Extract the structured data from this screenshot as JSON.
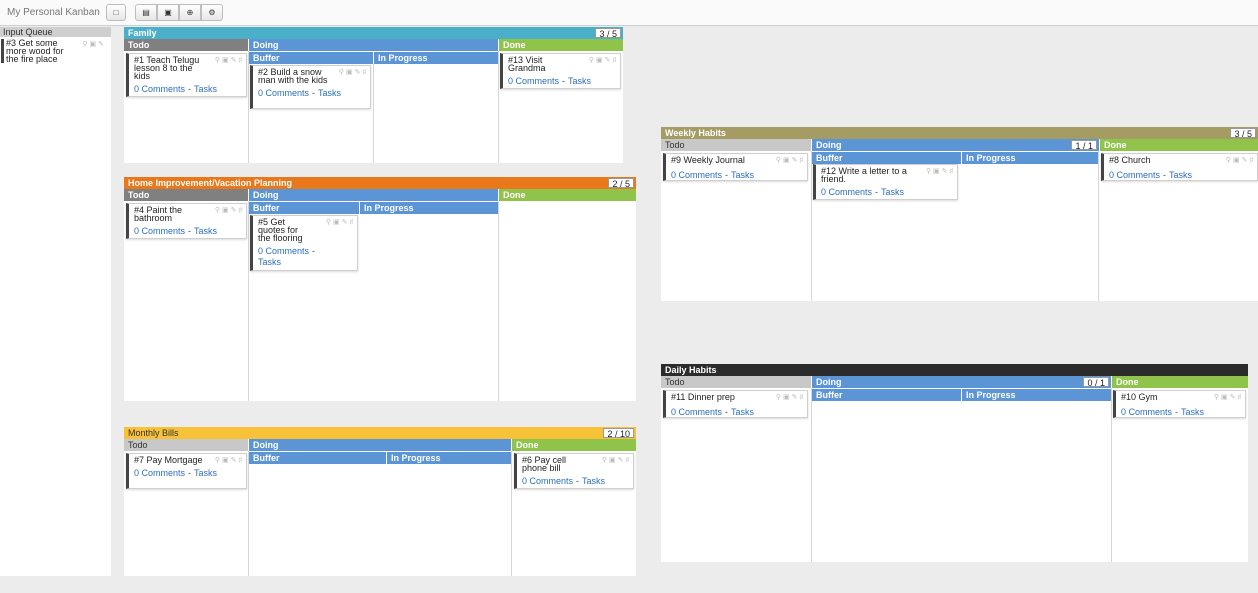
{
  "app": {
    "title": "My Personal Kanban"
  },
  "toolbar": {
    "toggle_icon": "square-outline-icon",
    "board_icon": "board-icon",
    "archive_icon": "archive-icon",
    "add_icon": "add-circle-icon",
    "settings_icon": "gear-icon"
  },
  "labels": {
    "comments": "0 Comments",
    "sep": "-",
    "tasks": "Tasks"
  },
  "input_queue": {
    "title": "Input Queue",
    "cards": [
      {
        "title": "#3 Get some more wood for the fire place"
      }
    ]
  },
  "boards": {
    "family": {
      "title": "Family",
      "wip": "3 / 5",
      "color": "#4ab0c9",
      "columns": {
        "todo": "Todo",
        "doing": "Doing",
        "buffer": "Buffer",
        "in_progress": "In Progress",
        "done": "Done"
      },
      "cards": {
        "todo": "#1 Teach Telugu lesson 8 to the kids",
        "buffer": "#2 Build a snow man with the kids",
        "done": "#13 Visit Grandma"
      }
    },
    "home": {
      "title": "Home Improvement/Vacation Planning",
      "wip": "2 / 5",
      "color": "#e8781a",
      "columns": {
        "todo": "Todo",
        "doing": "Doing",
        "buffer": "Buffer",
        "in_progress": "In Progress",
        "done": "Done"
      },
      "cards": {
        "todo": "#4 Paint the bathroom",
        "buffer": "#5 Get quotes for the flooring"
      }
    },
    "bills": {
      "title": "Monthly Bills",
      "wip": "2 / 10",
      "color": "#f7c238",
      "columns": {
        "todo": "Todo",
        "doing": "Doing",
        "buffer": "Buffer",
        "in_progress": "In Progress",
        "done": "Done"
      },
      "cards": {
        "todo": "#7 Pay Mortgage",
        "done": "#6 Pay cell phone bill"
      }
    },
    "weekly": {
      "title": "Weekly Habits",
      "wip": "3 / 5",
      "color": "#a59c64",
      "columns": {
        "todo": "Todo",
        "doing": "Doing",
        "doing_wip": "1 / 1",
        "buffer": "Buffer",
        "in_progress": "In Progress",
        "done": "Done"
      },
      "cards": {
        "todo": "#9 Weekly Journal",
        "buffer": "#12 Write a letter to a friend.",
        "done": "#8 Church"
      }
    },
    "daily": {
      "title": "Daily Habits",
      "color": "#2b2b2b",
      "columns": {
        "todo": "Todo",
        "doing": "Doing",
        "doing_wip": "0 / 1",
        "buffer": "Buffer",
        "in_progress": "In Progress",
        "done": "Done"
      },
      "cards": {
        "todo": "#11 Dinner prep",
        "done": "#10 Gym"
      }
    }
  }
}
